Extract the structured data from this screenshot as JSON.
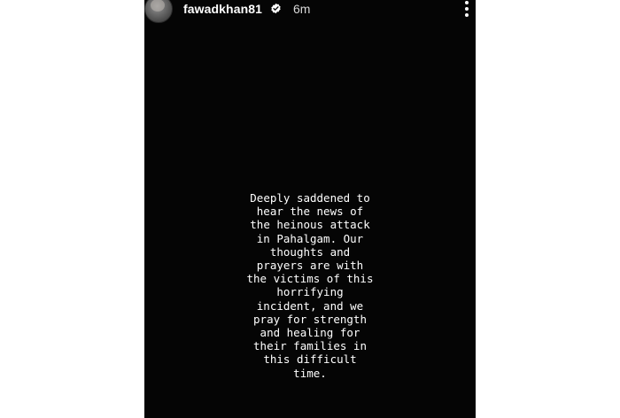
{
  "story": {
    "username": "fawadkhan81",
    "time_ago": "6m",
    "verified": true,
    "text": "Deeply saddened to\nhear the news of\nthe heinous attack\nin Pahalgam. Our\nthoughts and\nprayers are with\nthe victims of this\nhorrifying\nincident, and we\npray for strength\nand healing for\ntheir families in\nthis difficult\ntime."
  },
  "icons": {
    "avatar": "profile-avatar",
    "verified": "verified-badge-icon",
    "more": "more-options-icon"
  },
  "colors": {
    "story_background": "#050505",
    "page_background": "#ffffff",
    "text": "#ffffff"
  }
}
